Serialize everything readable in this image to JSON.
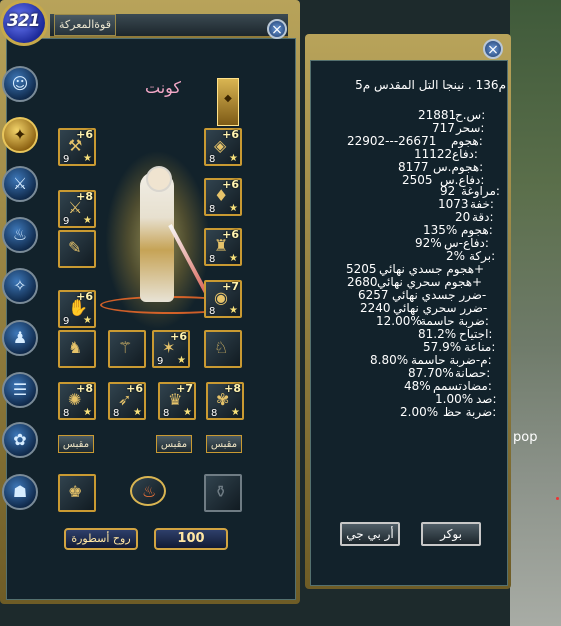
{
  "level": "321",
  "left_panel": {
    "tab": "قوةالمعركة",
    "char_name": "كونت",
    "banner_icon": "scroll-icon",
    "sub_buttons": [
      "مقبس",
      "مقبس",
      "مقبس"
    ],
    "bottom_buttons": [
      "روح أسطورة",
      "100"
    ],
    "side_icons": [
      "character-icon",
      "skills-icon",
      "weapon-icon",
      "fire-icon",
      "beast-icon",
      "team-icon",
      "book-icon",
      "pet-icon",
      "guild-icon"
    ],
    "slots": [
      {
        "plus": "+6",
        "lvl": "9"
      },
      {
        "plus": "+6",
        "lvl": "8"
      },
      {
        "plus": "+8",
        "lvl": "9"
      },
      {
        "plus": "+6",
        "lvl": "8"
      },
      {
        "plus": "",
        "lvl": ""
      },
      {
        "plus": "+6",
        "lvl": "8"
      },
      {
        "plus": "+6",
        "lvl": "9"
      },
      {
        "plus": "+7",
        "lvl": "8"
      },
      {
        "plus": "",
        "lvl": ""
      },
      {
        "plus": "",
        "lvl": ""
      },
      {
        "plus": "+6",
        "lvl": "9"
      },
      {
        "plus": "",
        "lvl": ""
      },
      {
        "plus": "+8",
        "lvl": "8"
      },
      {
        "plus": "+6",
        "lvl": "8"
      },
      {
        "plus": "+7",
        "lvl": "8"
      },
      {
        "plus": "+8",
        "lvl": "8"
      }
    ]
  },
  "right_panel": {
    "title": "م136 .  نينجا التل المقدس م5",
    "stats": [
      {
        "label": "س.ح:",
        "value": "21881"
      },
      {
        "label": "سحر:",
        "value": "717"
      },
      {
        "label": "هجوم:",
        "value": "22902---26671"
      },
      {
        "label": "دفاع:",
        "value": "11122"
      },
      {
        "label": "هجوم.س:",
        "value": "8177"
      },
      {
        "label": "دفاع.س:",
        "value": "2505"
      },
      {
        "label": "مراوغة:",
        "value": "92"
      },
      {
        "label": "خفة:",
        "value": "1073"
      },
      {
        "label": "دقة:",
        "value": "20"
      },
      {
        "label": "هجوم:",
        "value": "135%"
      },
      {
        "label": "دفاع-س:",
        "value": "92%"
      },
      {
        "label": "بركة:",
        "value": "2%"
      },
      {
        "label": "هجوم جسدي نهائي+",
        "value": "5205"
      },
      {
        "label": "هجوم سحري نهائي+",
        "value": "2680"
      },
      {
        "label": "ضرر جسدي نهائي-",
        "value": "6257"
      },
      {
        "label": "ضرر سحري نهائي-",
        "value": "2240"
      },
      {
        "label": "ضربة حاسمة:",
        "value": "12.00%"
      },
      {
        "label": "اجتياح:",
        "value": "81.2%"
      },
      {
        "label": "مناعة:",
        "value": "57.9%"
      },
      {
        "label": "م-ضربة حاسمة:",
        "value": "8.80%"
      },
      {
        "label": "حصانة:",
        "value": "87.70%"
      },
      {
        "label": "مضادتسمم:",
        "value": "48%"
      },
      {
        "label": "صد:",
        "value": "1.00%"
      },
      {
        "label": "ضربة حظ:",
        "value": "2.00%"
      }
    ],
    "buttons": [
      "أر بي جي",
      "بوكر"
    ]
  },
  "scene": {
    "text": "pop"
  }
}
